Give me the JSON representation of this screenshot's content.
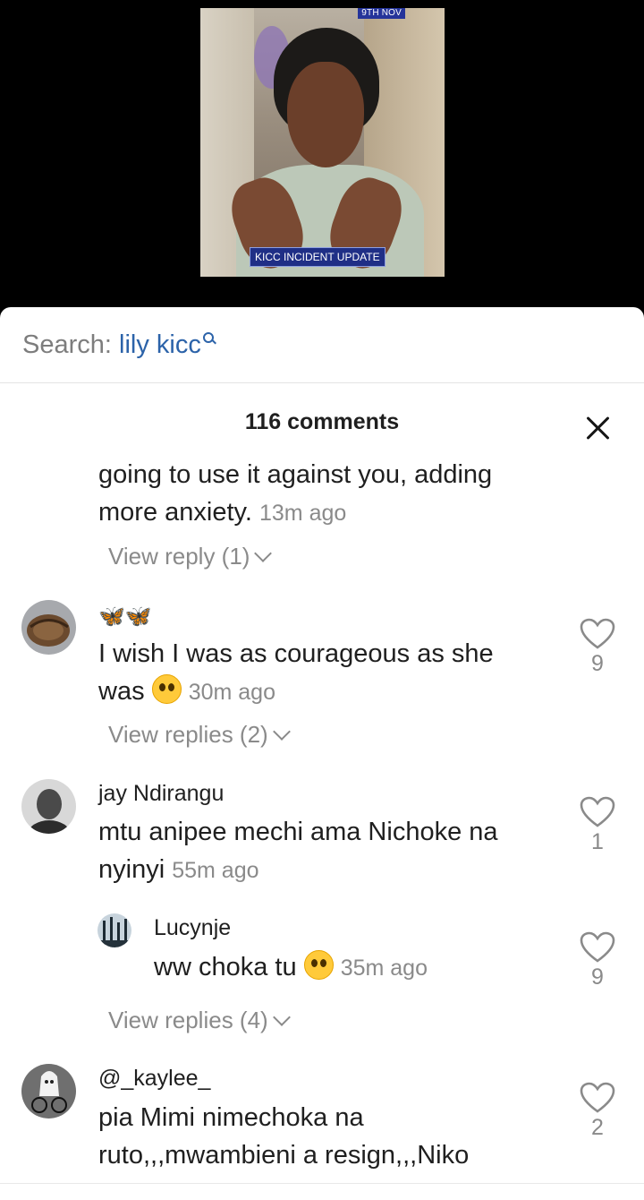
{
  "video": {
    "date_badge": "9TH NOV",
    "caption_badge": "KICC INCIDENT UPDATE"
  },
  "search": {
    "prefix": "Search:",
    "term": "lily kicc"
  },
  "comments_header": {
    "title": "116 comments"
  },
  "comments": [
    {
      "text_line1": "going to use it against you, adding",
      "text_line2": "more anxiety.",
      "time": "13m ago",
      "view_replies": "View reply (1)"
    },
    {
      "username_emoji": "🦋🦋",
      "text_line1": "I wish I was as courageous as she",
      "text_line2": "was",
      "emoji": "pleading-face",
      "time": "30m ago",
      "likes": "9",
      "view_replies": "View replies (2)"
    },
    {
      "username": "jay Ndirangu",
      "text_line1": "mtu anipee mechi ama Nichoke na",
      "text_line2": "nyinyi",
      "time": "55m ago",
      "likes": "1",
      "reply": {
        "username": "Lucynje",
        "text": "ww choka tu",
        "emoji": "grinning-face-with-sweat",
        "time": "35m ago",
        "likes": "9"
      },
      "view_replies": "View replies (4)"
    },
    {
      "username": "@_kaylee_",
      "text_line1": "pia Mimi nimechoka na",
      "text_line2": "ruto,,,mwambieni a resign,,,Niko",
      "likes": "2"
    }
  ],
  "colors": {
    "search_term": "#2c63a9",
    "muted": "#8a8a8a",
    "badge_blue": "#1f2f86"
  }
}
